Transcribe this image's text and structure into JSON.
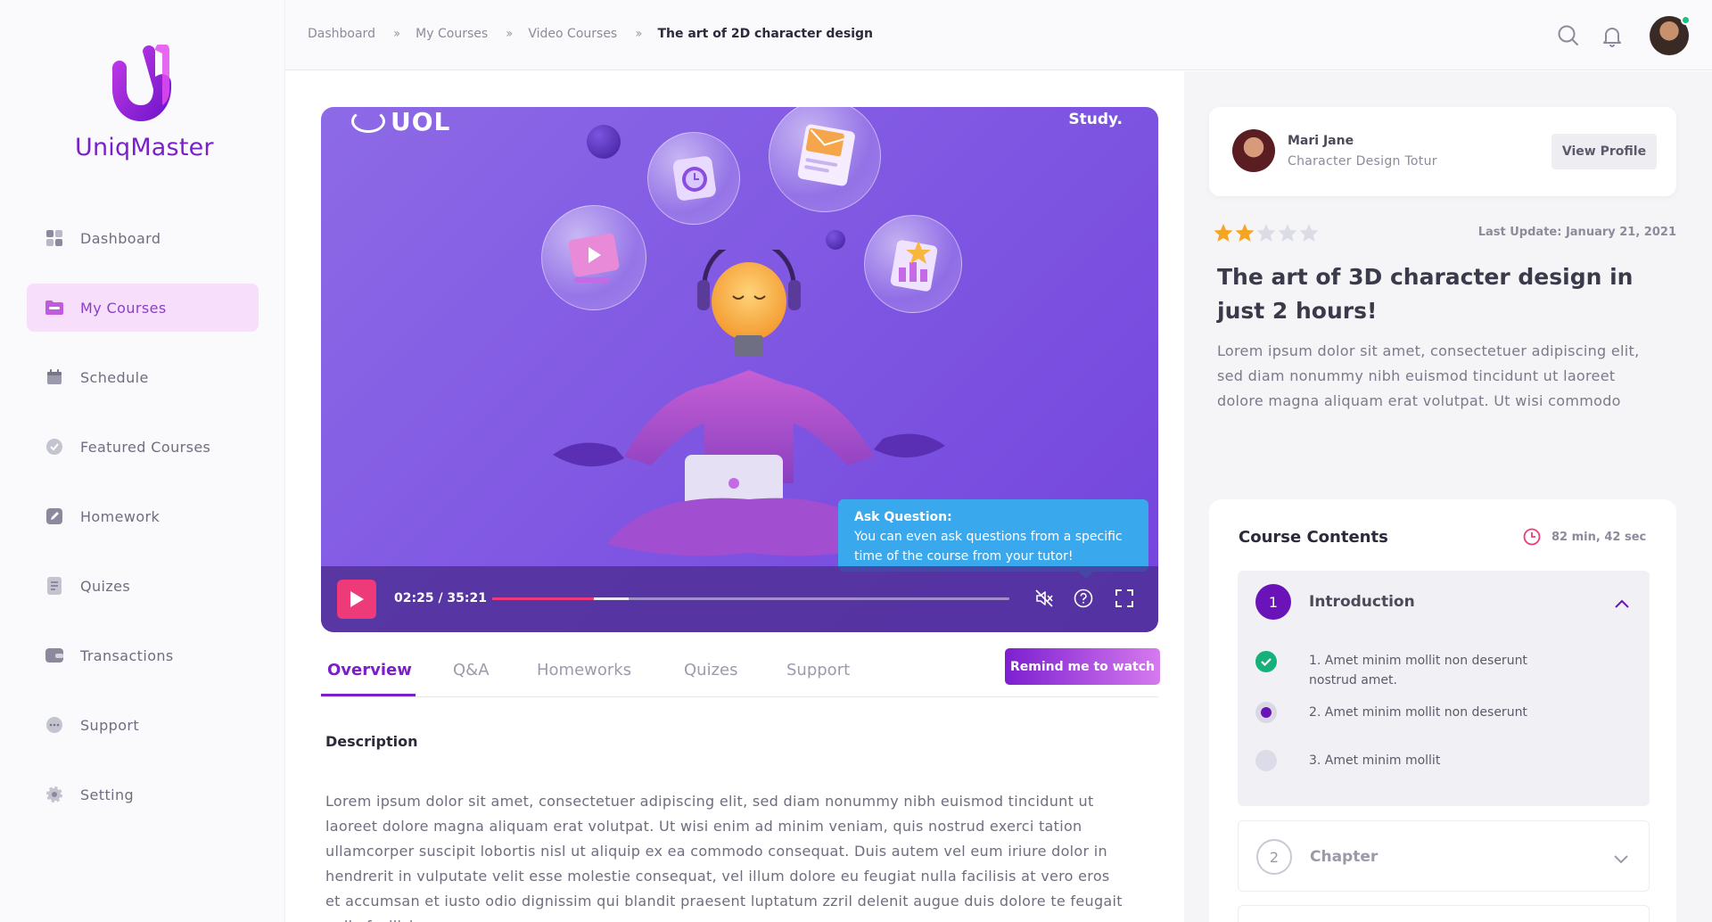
{
  "app": {
    "name": "UniqMaster",
    "brand_color": "#7a1fc9",
    "accent_color": "#ef3a7a"
  },
  "sidebar": {
    "items": [
      {
        "label": "Dashboard",
        "icon": "grid-icon"
      },
      {
        "label": "My Courses",
        "icon": "folder-icon",
        "active": true
      },
      {
        "label": "Schedule",
        "icon": "calendar-icon"
      },
      {
        "label": "Featured Courses",
        "icon": "badge-icon"
      },
      {
        "label": "Homework",
        "icon": "edit-icon"
      },
      {
        "label": "Quizes",
        "icon": "document-icon"
      },
      {
        "label": "Transactions",
        "icon": "wallet-icon"
      },
      {
        "label": "Support",
        "icon": "chat-icon"
      },
      {
        "label": "Setting",
        "icon": "gear-icon"
      }
    ]
  },
  "breadcrumb": {
    "items": [
      "Dashboard",
      "My Courses",
      "Video Courses"
    ],
    "current": "The art of  2D character design"
  },
  "video": {
    "brand_text": "UOL",
    "corner_text": "Study.",
    "current_time": "02:25 / 35:21",
    "progress_fraction": 0.196,
    "buffered_fraction": 0.264,
    "tooltip_title": "Ask Question:",
    "tooltip_text": "You can even ask questions from a specific time of the course from your tutor!"
  },
  "tabs": {
    "items": [
      "Overview",
      "Q&A",
      "Homeworks",
      "Quizes",
      "Support"
    ],
    "active": "Overview",
    "remind_label": "Remind me to watch"
  },
  "description": {
    "title": "Description",
    "text": "Lorem ipsum dolor sit amet, consectetuer adipiscing elit, sed diam nonummy nibh euismod tincidunt ut laoreet dolore magna aliquam erat volutpat. Ut wisi enim ad minim veniam, quis nostrud exerci tation ullamcorper suscipit lobortis nisl ut aliquip ex ea commodo consequat. Duis autem vel eum iriure dolor in hendrerit in vulputate velit esse molestie consequat, vel illum dolore eu feugiat nulla facilisis at vero eros et accumsan et iusto odio dignissim qui blandit praesent luptatum zzril delenit augue duis dolore te feugait nulla facilisi."
  },
  "tutor": {
    "name": "Mari Jane",
    "role": "Character Design Totur",
    "button": "View Profile"
  },
  "course": {
    "rating": 2,
    "rating_max": 5,
    "last_update": "Last Update: January 21, 2021",
    "title": "The art of  3D character design in just 2 hours!",
    "description": "Lorem ipsum dolor sit amet, consectetuer adipiscing elit, sed diam nonummy nibh euismod tincidunt ut laoreet dolore magna aliquam erat volutpat. Ut wisi commodo"
  },
  "contents": {
    "title": "Course Contents",
    "duration": "82 min, 42 sec",
    "sections": [
      {
        "number": "1",
        "title": "Introduction",
        "lessons": [
          {
            "label": "1. Amet minim mollit non deserunt nostrud amet.",
            "status": "done"
          },
          {
            "label": "2. Amet minim mollit non deserunt",
            "status": "current"
          },
          {
            "label": "3. Amet minim mollit",
            "status": "pending"
          }
        ]
      },
      {
        "number": "2",
        "title": "Chapter"
      }
    ]
  }
}
